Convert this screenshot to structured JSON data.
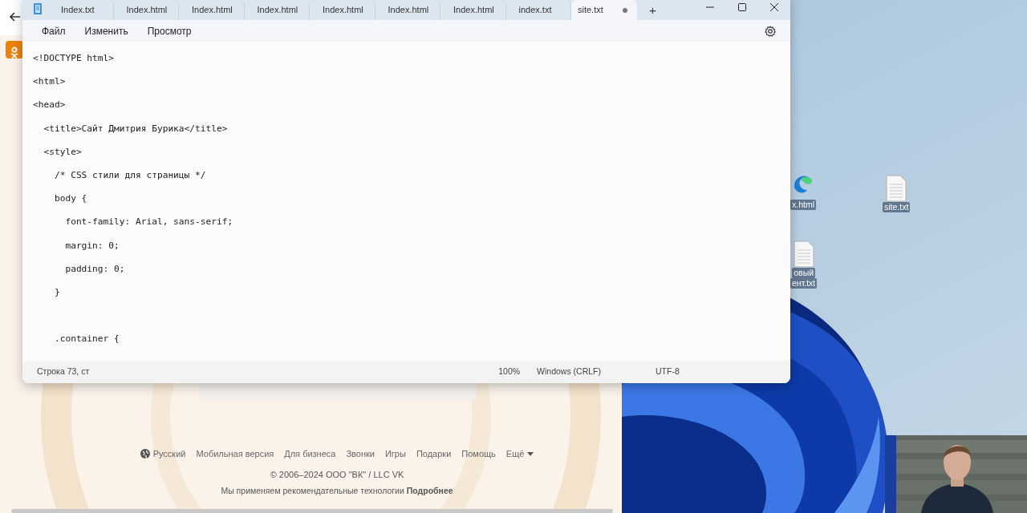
{
  "browser": {
    "footer_links": [
      {
        "label": "Русский",
        "kind": "language"
      },
      {
        "label": "Мобильная версия",
        "kind": "link"
      },
      {
        "label": "Для бизнеса",
        "kind": "link"
      },
      {
        "label": "Звонки",
        "kind": "link"
      },
      {
        "label": "Игры",
        "kind": "link"
      },
      {
        "label": "Подарки",
        "kind": "link"
      },
      {
        "label": "Помощь",
        "kind": "link"
      },
      {
        "label": "Ещё",
        "kind": "more"
      }
    ],
    "copyright": "© 2006–2024 ООО \"ВК\" / LLC VK",
    "notice": "Мы применяем рекомендательные технологии **Подробнее**"
  },
  "desktop": {
    "icons": [
      {
        "kind": "browser",
        "label_lines": [
          "x.html"
        ]
      },
      {
        "kind": "text",
        "label_lines": [
          "site.txt"
        ]
      },
      {
        "kind": "text",
        "label_lines": [
          "овый",
          "ент.txt"
        ]
      }
    ]
  },
  "notepad": {
    "tabs": [
      {
        "label": "Index.txt",
        "selected": false,
        "modified": false
      },
      {
        "label": "Index.html",
        "selected": false,
        "modified": false
      },
      {
        "label": "Index.html",
        "selected": false,
        "modified": false
      },
      {
        "label": "Index.html",
        "selected": false,
        "modified": false
      },
      {
        "label": "Index.html",
        "selected": false,
        "modified": false
      },
      {
        "label": "Index.html",
        "selected": false,
        "modified": false
      },
      {
        "label": "Index.html",
        "selected": false,
        "modified": false
      },
      {
        "label": "index.txt",
        "selected": false,
        "modified": false
      },
      {
        "label": "site.txt",
        "selected": true,
        "modified": true
      }
    ],
    "new_tab": "+",
    "menu": [
      "Файл",
      "Изменить",
      "Просмотр"
    ],
    "lines": [
      "<!DOCTYPE html>",
      "<html>",
      "<head>",
      "  <title>Сайт Дмитрия Бурика</title>",
      "  <style>",
      "    /* CSS стили для страницы */",
      "    body {",
      "      font-family: Arial, sans-serif;",
      "      margin: 0;",
      "      padding: 0;",
      "    }",
      {
        "text": "    .container {",
        "gap_before": true
      }
    ],
    "status_bar": {
      "position": "Строка 73, ст",
      "zoom": "100%",
      "line_ending": "Windows (CRLF)",
      "encoding": "UTF-8"
    }
  }
}
